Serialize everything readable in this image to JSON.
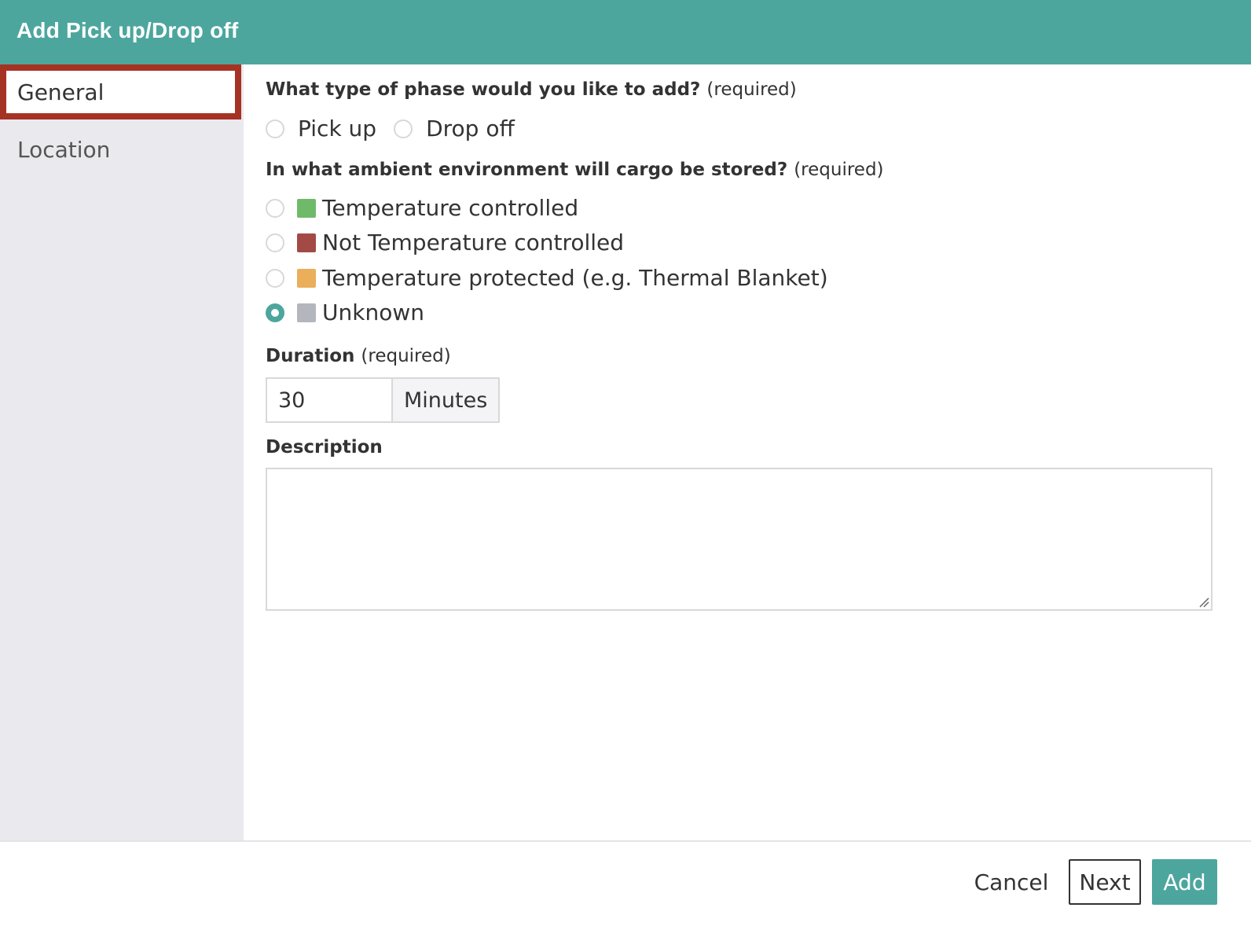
{
  "dialog": {
    "title": "Add Pick up/Drop off"
  },
  "sidebar": {
    "items": [
      {
        "label": "General",
        "active": true
      },
      {
        "label": "Location",
        "active": false
      }
    ]
  },
  "phase_question": {
    "label": "What type of phase would you like to add?",
    "required": "(required)",
    "options": [
      {
        "label": "Pick up",
        "checked": false
      },
      {
        "label": "Drop off",
        "checked": false
      }
    ]
  },
  "environment_question": {
    "label": "In what ambient environment will cargo be stored?",
    "required": "(required)",
    "options": [
      {
        "label": "Temperature controlled",
        "color": "#6fba69",
        "checked": false
      },
      {
        "label": "Not Temperature controlled",
        "color": "#a34a47",
        "checked": false
      },
      {
        "label": "Temperature protected (e.g. Thermal Blanket)",
        "color": "#ebae5b",
        "checked": false
      },
      {
        "label": "Unknown",
        "color": "#b3b6bd",
        "checked": true
      }
    ]
  },
  "duration": {
    "label": "Duration",
    "required": "(required)",
    "value": "30",
    "unit": "Minutes"
  },
  "description": {
    "label": "Description",
    "value": ""
  },
  "footer": {
    "cancel_label": "Cancel",
    "next_label": "Next",
    "add_label": "Add"
  },
  "colors": {
    "accent": "#4ca69e",
    "active_border": "#a63224",
    "sidebar_bg": "#eaeaee"
  }
}
